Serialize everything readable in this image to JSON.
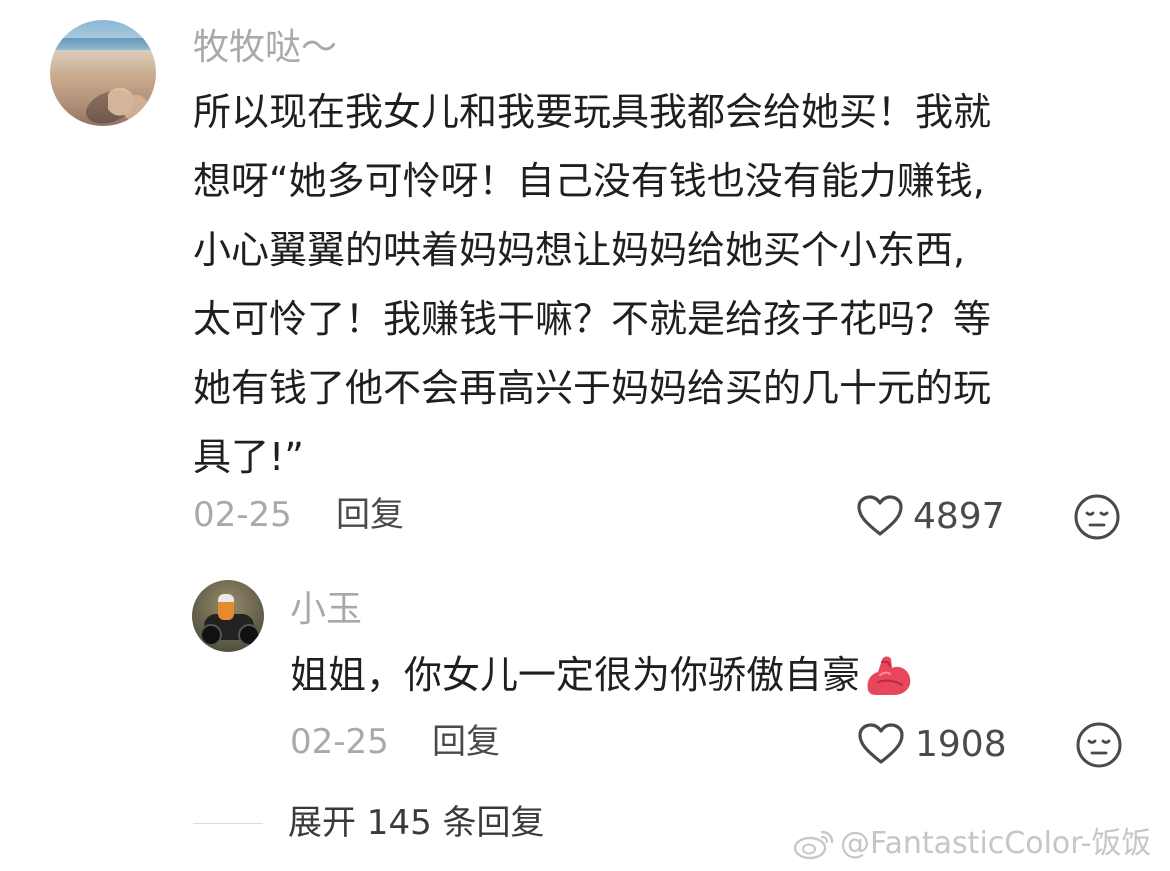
{
  "comment": {
    "username": "牧牧哒～",
    "lines": [
      "所以现在我女儿和我要玩具我都会给她买！我就",
      "想呀“她多可怜呀！自己没有钱也没有能力赚钱,",
      "小心翼翼的哄着妈妈想让妈妈给她买个小东西,",
      "太可怜了！我赚钱干嘛？不就是给孩子花吗？等",
      "她有钱了他不会再高兴于妈妈给买的几十元的玩",
      "具了!”"
    ],
    "date": "02-25",
    "reply_label": "回复",
    "like_count": "4897",
    "icons": {
      "like": "heart-outline-icon",
      "dislike": "meh-face-icon",
      "avatar": "beach-avatar"
    }
  },
  "reply": {
    "username": "小玉",
    "text": "姐姐，你女儿一定很为你骄傲自豪",
    "emoji": "flexed-biceps-icon",
    "date": "02-25",
    "reply_label": "回复",
    "like_count": "1908",
    "icons": {
      "like": "heart-outline-icon",
      "dislike": "meh-face-icon",
      "avatar": "motorcycle-avatar"
    }
  },
  "expand": {
    "label": "展开 145 条回复"
  },
  "watermark": {
    "text": "@FantasticColor-饭饭",
    "icon": "weibo-logo-icon"
  },
  "colors": {
    "username": "#a9a9a9",
    "text": "#1f1f1f",
    "meta": "#a9a9a9",
    "action": "#4a4a4a",
    "emoji": "#e8465c"
  }
}
